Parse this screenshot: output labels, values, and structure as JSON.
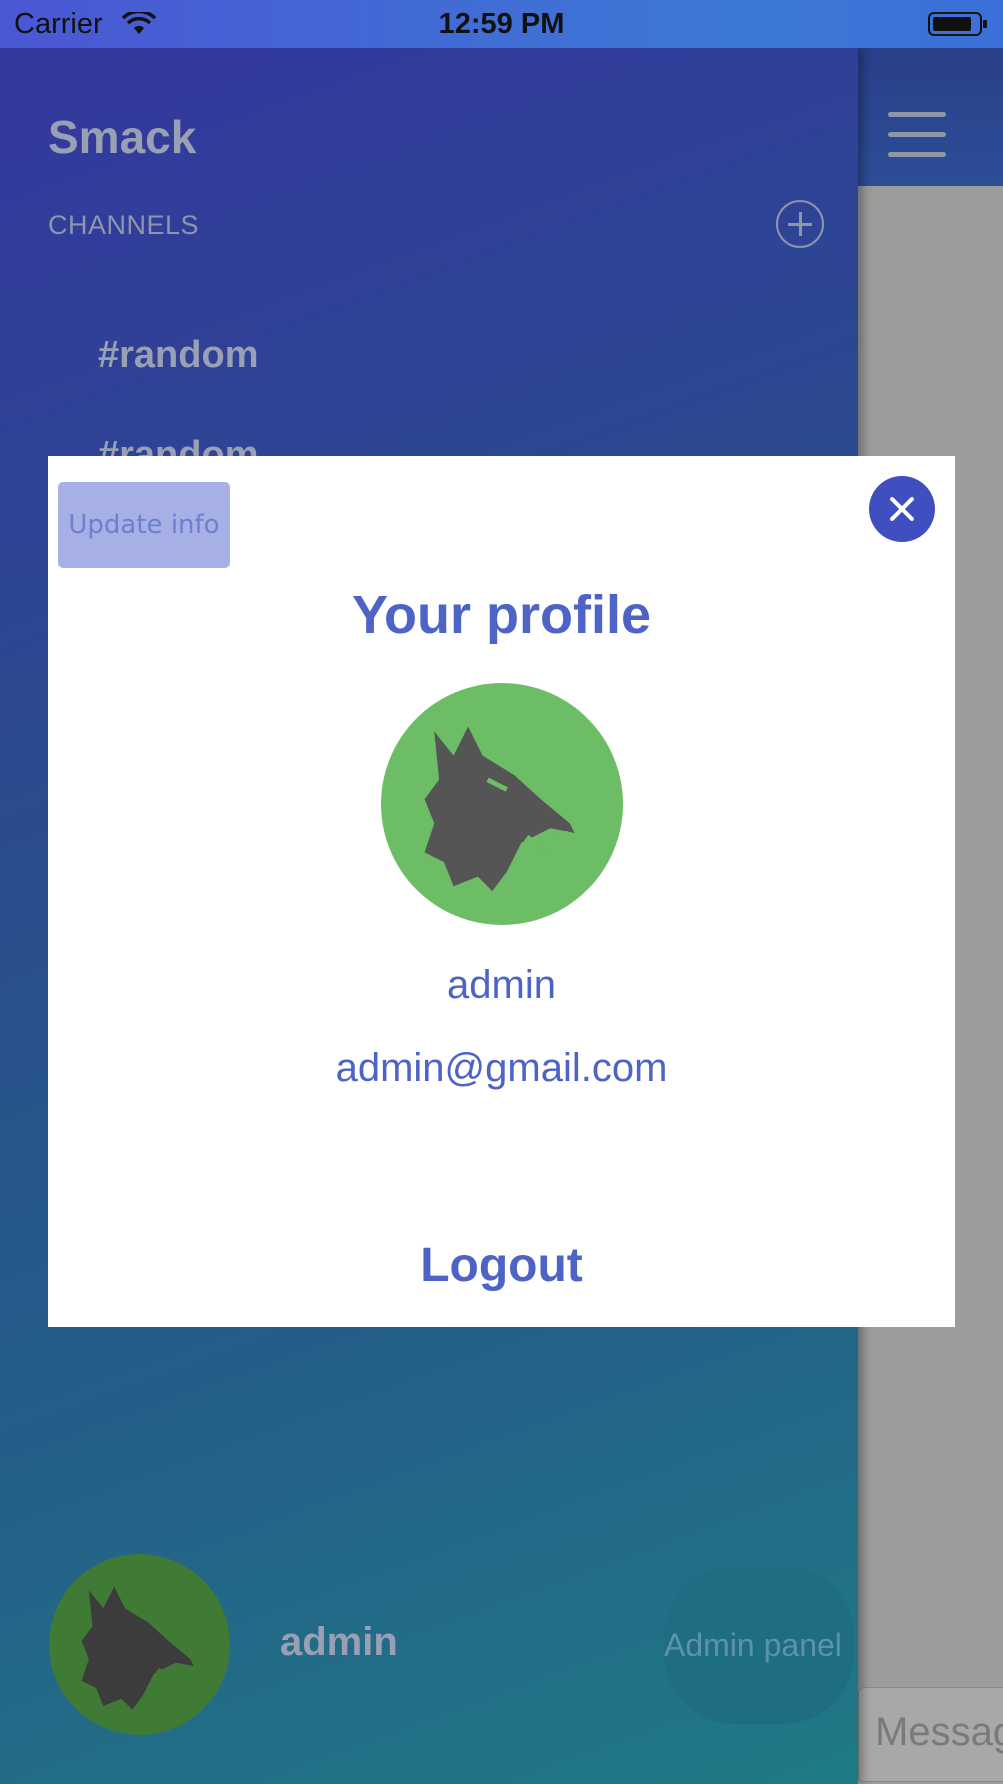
{
  "status_bar": {
    "carrier": "Carrier",
    "time": "12:59 PM"
  },
  "side_menu": {
    "app_title": "Smack",
    "channels_label": "CHANNELS",
    "channels": [
      "#random",
      "#random"
    ],
    "user_name": "admin",
    "admin_panel_label": "Admin panel"
  },
  "main": {
    "message_placeholder": "Message"
  },
  "profile_modal": {
    "update_button": "Update info",
    "title": "Your profile",
    "username": "admin",
    "email": "admin@gmail.com",
    "logout": "Logout"
  },
  "colors": {
    "accent": "#4d63c6",
    "close_button": "#3f4fbf",
    "avatar_bg": "#6dbd67"
  }
}
